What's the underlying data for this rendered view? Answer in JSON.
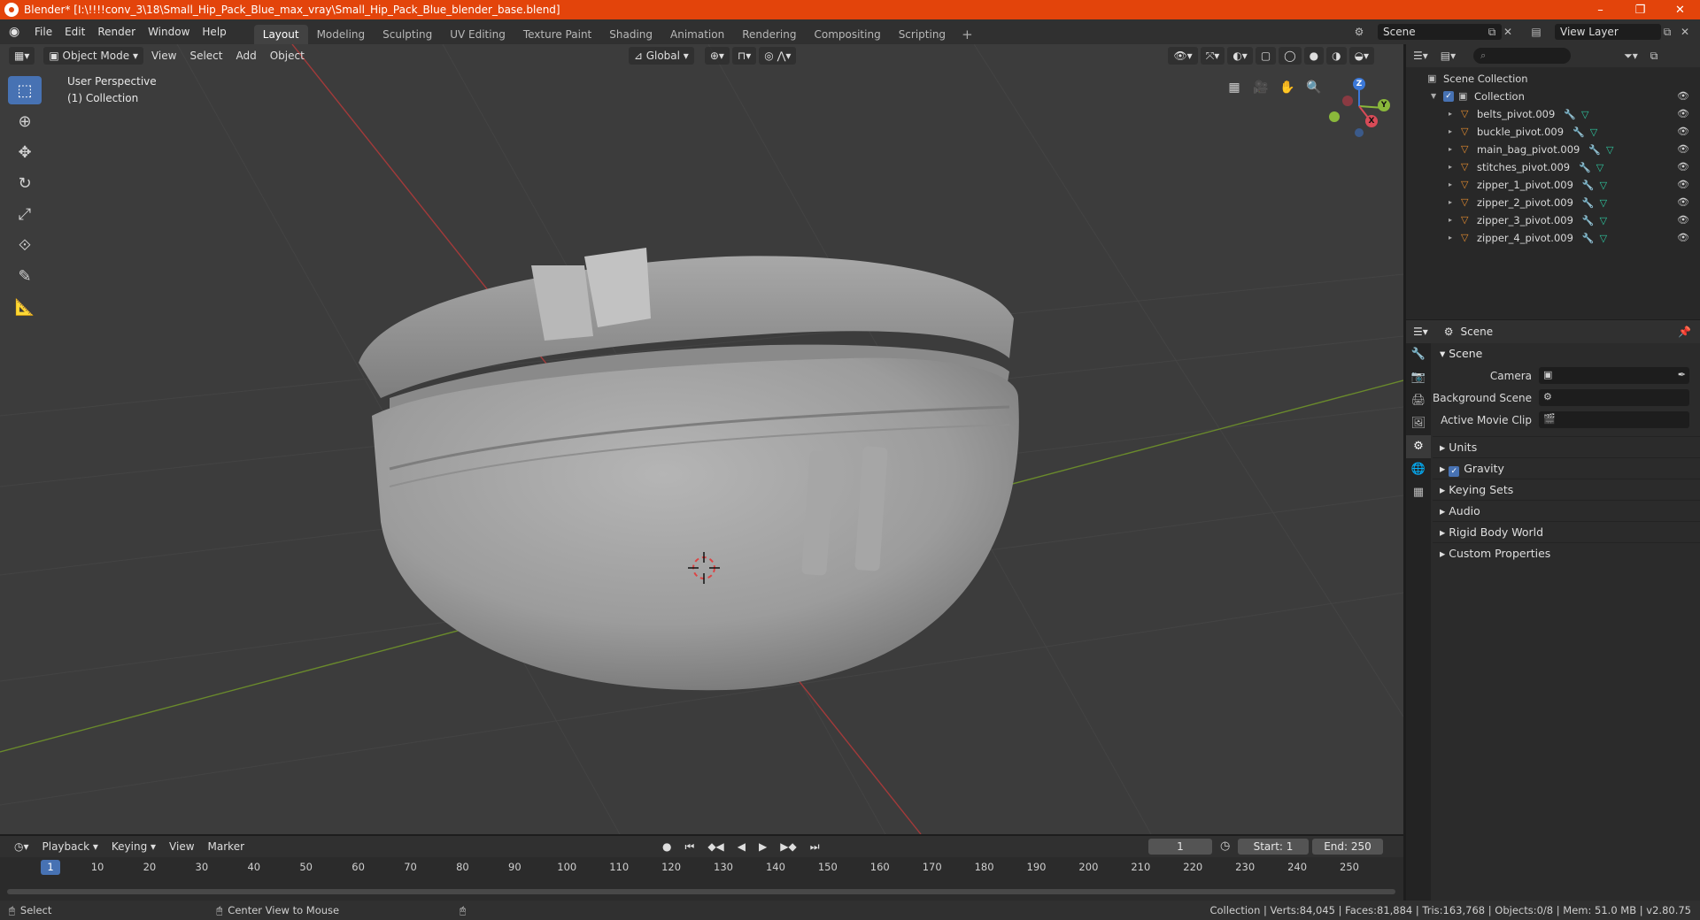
{
  "window": {
    "title": "Blender* [I:\\!!!!conv_3\\18\\Small_Hip_Pack_Blue_max_vray\\Small_Hip_Pack_Blue_blender_base.blend]",
    "minimize": "–",
    "maximize": "❐",
    "close": "✕"
  },
  "menubar": {
    "items": [
      "File",
      "Edit",
      "Render",
      "Window",
      "Help"
    ]
  },
  "workspaces": {
    "tabs": [
      "Layout",
      "Modeling",
      "Sculpting",
      "UV Editing",
      "Texture Paint",
      "Shading",
      "Animation",
      "Rendering",
      "Compositing",
      "Scripting"
    ],
    "active": "Layout",
    "add": "+"
  },
  "scene_selector": {
    "value": "Scene"
  },
  "view_layer_selector": {
    "value": "View Layer"
  },
  "viewport": {
    "mode": "Object Mode",
    "menus": [
      "View",
      "Select",
      "Add",
      "Object"
    ],
    "orientation": "Global",
    "perspective_label": "User Perspective",
    "collection_label": "(1) Collection",
    "gizmo": {
      "x": "X",
      "y": "Y",
      "z": "Z"
    }
  },
  "outliner": {
    "root": "Scene Collection",
    "collection": "Collection",
    "objects": [
      "belts_pivot.009",
      "buckle_pivot.009",
      "main_bag_pivot.009",
      "stitches_pivot.009",
      "zipper_1_pivot.009",
      "zipper_2_pivot.009",
      "zipper_3_pivot.009",
      "zipper_4_pivot.009"
    ]
  },
  "properties": {
    "header": "Scene",
    "panel": "Scene",
    "fields": [
      {
        "label": "Camera"
      },
      {
        "label": "Background Scene"
      },
      {
        "label": "Active Movie Clip"
      }
    ],
    "subpanels": [
      "Units",
      "Gravity",
      "Keying Sets",
      "Audio",
      "Rigid Body World",
      "Custom Properties"
    ],
    "gravity_checked": true
  },
  "timeline": {
    "menus": [
      "Playback",
      "Keying",
      "View",
      "Marker"
    ],
    "current_frame": "1",
    "start_label": "Start:",
    "start": "1",
    "end_label": "End:",
    "end": "250",
    "ticks": [
      "1",
      "10",
      "20",
      "30",
      "40",
      "50",
      "60",
      "70",
      "80",
      "90",
      "100",
      "110",
      "120",
      "130",
      "140",
      "150",
      "160",
      "170",
      "180",
      "190",
      "200",
      "210",
      "220",
      "230",
      "240",
      "250"
    ]
  },
  "statusbar": {
    "select": "Select",
    "center_view": "Center View to Mouse",
    "stats": "Collection | Verts:84,045 | Faces:81,884 | Tris:163,768 | Objects:0/8 | Mem: 51.0 MB | v2.80.75"
  },
  "colors": {
    "titlebar": "#e3440b",
    "accent": "#4772b3",
    "viewport_bg": "#3c3c3c",
    "object_icon": "#e38b2f",
    "mesh_icon": "#2fc7a0"
  }
}
